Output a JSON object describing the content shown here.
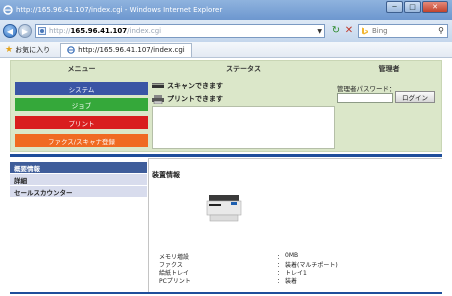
{
  "window": {
    "title": "http://165.96.41.107/index.cgi - Windows Internet Explorer",
    "minimize_glyph": "─",
    "maximize_glyph": "□",
    "close_glyph": "✕"
  },
  "address_bar": {
    "url_prefix": "http://",
    "url_host": "165.96.41.107",
    "url_path": "/index.cgi",
    "search_placeholder": "Bing",
    "back_glyph": "◀",
    "forward_glyph": "▶",
    "refresh_glyph": "↻",
    "stop_glyph": "✕",
    "search_glyph": "⚲"
  },
  "favorites_bar": {
    "favorites_label": "お気に入り",
    "tab_label": "http://165.96.41.107/index.cgi"
  },
  "top_panel": {
    "menu_header": "メニュー",
    "status_header": "ステータス",
    "admin_header": "管理者",
    "menu_items": [
      {
        "label": "システム",
        "color": "#3a55a5"
      },
      {
        "label": "ジョブ",
        "color": "#35a83a"
      },
      {
        "label": "プリント",
        "color": "#d91e1e"
      },
      {
        "label": "ファクス/スキャナ登録",
        "color": "#f06a22"
      }
    ],
    "status": {
      "scan_text": "スキャンできます",
      "print_text": "プリントできます"
    },
    "admin": {
      "password_label": "管理者パスワード：",
      "password_value": "",
      "login_button": "ログイン"
    }
  },
  "side_nav": {
    "items": [
      {
        "label": "概要情報",
        "active": true
      },
      {
        "label": "詳細",
        "active": false
      },
      {
        "label": "セールスカウンター",
        "active": false
      }
    ]
  },
  "device_info": {
    "title": "装置情報",
    "rows": [
      {
        "label": "メモリ増設",
        "value": "0MB"
      },
      {
        "label": "ファクス",
        "value": "装着(マルチポート)"
      },
      {
        "label": "給紙トレイ",
        "value": "トレイ1"
      },
      {
        "label": "PCプリント",
        "value": "装着"
      }
    ],
    "colon": "："
  },
  "colors": {
    "panel_bg": "#dbe7c9",
    "accent_blue": "#1f4e9b",
    "side_active": "#3f5d9a",
    "side_inactive": "#d8dced"
  }
}
